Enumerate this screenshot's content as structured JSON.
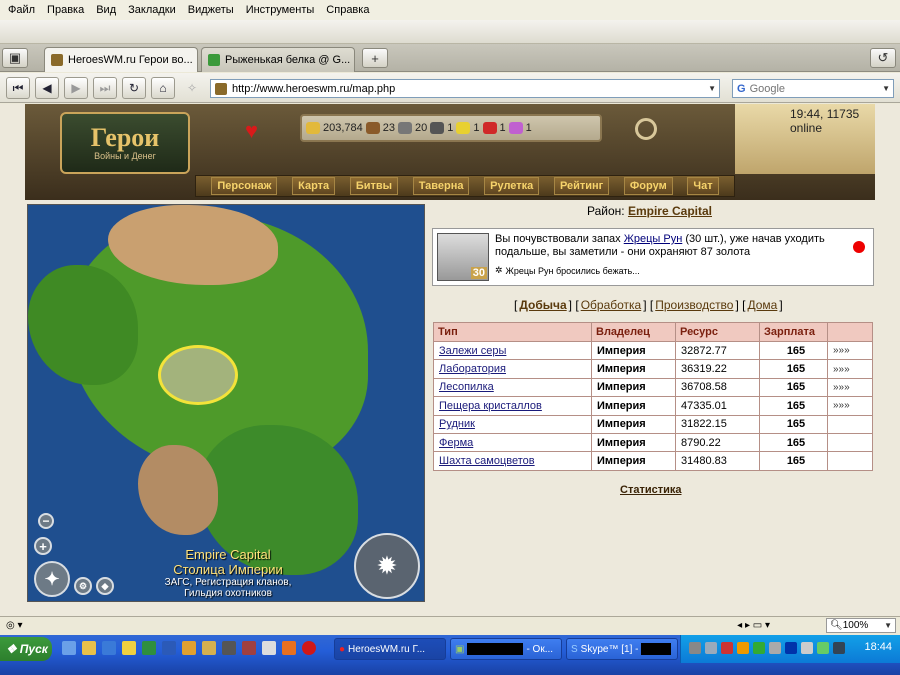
{
  "menu": [
    "Файл",
    "Правка",
    "Вид",
    "Закладки",
    "Виджеты",
    "Инструменты",
    "Справка"
  ],
  "tabs": [
    {
      "title": "HeroesWM.ru Герои во...",
      "active": true
    },
    {
      "title": "Рыженькая белка @ G...",
      "active": false
    }
  ],
  "nav": {
    "url": "http://www.heroeswm.ru/map.php",
    "search_placeholder": "Google"
  },
  "header": {
    "online": "19:44, 11735 online",
    "logo_title": "Герои",
    "logo_subtitle": "Войны и Денег",
    "resources": [
      "203,784",
      "23",
      "20",
      "1",
      "1",
      "1",
      "1"
    ]
  },
  "game_nav": [
    "Персонаж",
    "Карта",
    "Битвы",
    "Таверна",
    "Рулетка",
    "Рейтинг",
    "Форум",
    "Чат"
  ],
  "map": {
    "title": "Empire Capital",
    "subtitle": "Столица Империи",
    "desc1": "ЗАГС, Регистрация кланов,",
    "desc2": "Гильдия охотников"
  },
  "district": {
    "label": "Район:",
    "name": "Empire Capital"
  },
  "event": {
    "level": "30",
    "text_pre": "Вы почувствовали запах",
    "link": "Жрецы Рун",
    "text_post": "(30 шт.), уже начав уходить подальше, вы заметили - они охраняют 87 золота",
    "status": "Жрецы Рун бросились бежать..."
  },
  "subtabs": [
    "Добыча",
    "Обработка",
    "Производство",
    "Дома"
  ],
  "table": {
    "headers": [
      "Тип",
      "Владелец",
      "Ресурс",
      "Зарплата",
      ""
    ],
    "rows": [
      {
        "type": "Залежи серы",
        "owner": "Империя",
        "resource": "32872.77",
        "salary": "165",
        "more": "»»»"
      },
      {
        "type": "Лаборатория",
        "owner": "Империя",
        "resource": "36319.22",
        "salary": "165",
        "more": "»»»"
      },
      {
        "type": "Лесопилка",
        "owner": "Империя",
        "resource": "36708.58",
        "salary": "165",
        "more": "»»»"
      },
      {
        "type": "Пещера кристаллов",
        "owner": "Империя",
        "resource": "47335.01",
        "salary": "165",
        "more": "»»»"
      },
      {
        "type": "Рудник",
        "owner": "Империя",
        "resource": "31822.15",
        "salary": "165",
        "more": ""
      },
      {
        "type": "Ферма",
        "owner": "Империя",
        "resource": "8790.22",
        "salary": "165",
        "more": ""
      },
      {
        "type": "Шахта самоцветов",
        "owner": "Империя",
        "resource": "31480.83",
        "salary": "165",
        "more": ""
      }
    ]
  },
  "stats_link": "Статистика",
  "status": {
    "zoom": "100%"
  },
  "taskbar": {
    "start": "Пуск",
    "buttons": [
      "HeroesWM.ru Г...",
      "- Ок...",
      "Skype™ [1] -"
    ],
    "clock": "18:44"
  }
}
